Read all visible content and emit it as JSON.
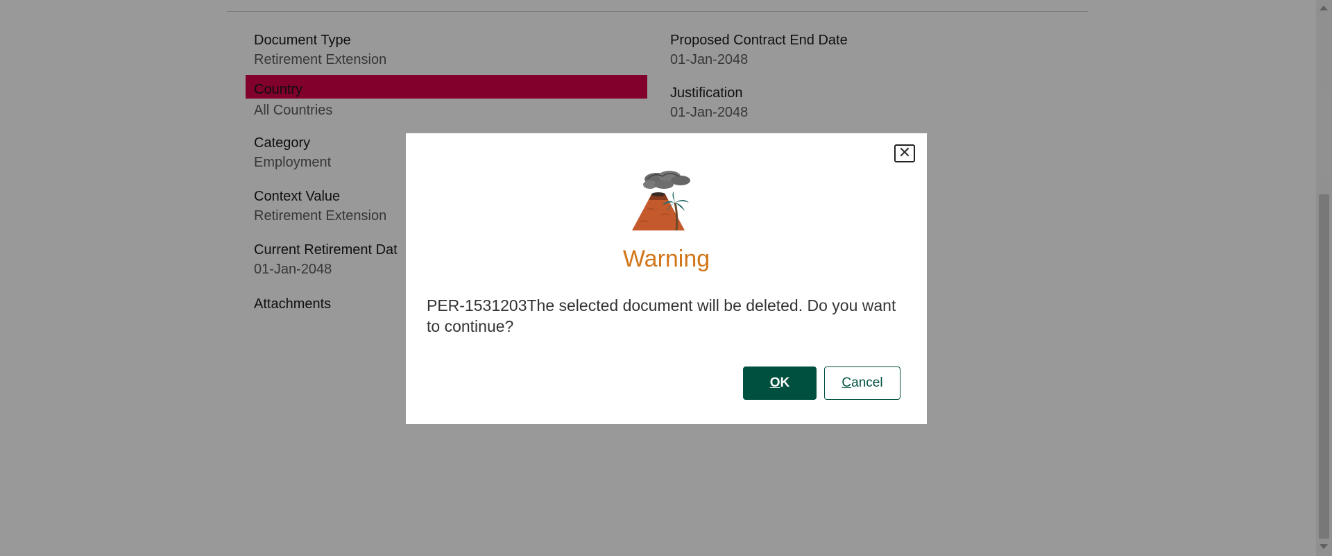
{
  "form": {
    "left_fields": [
      {
        "label": "Document Type",
        "value": "Retirement Extension"
      },
      {
        "label": "Country",
        "value": "All Countries"
      },
      {
        "label": "Category",
        "value": "Employment"
      },
      {
        "label": "Context Value",
        "value": "Retirement Extension"
      },
      {
        "label": "Current Retirement Dat",
        "value": "01-Jan-2048"
      },
      {
        "label": "Attachments",
        "value": ""
      }
    ],
    "right_fields": [
      {
        "label": "Proposed Contract End Date",
        "value": "01-Jan-2048"
      },
      {
        "label": "Justification",
        "value": "01-Jan-2048"
      }
    ]
  },
  "dialog": {
    "close_symbol": "✕",
    "icon": "volcano-icon",
    "title": "Warning",
    "message": "PER-1531203The selected document will be deleted. Do you want to continue?",
    "ok_label": {
      "accel": "O",
      "rest": "K"
    },
    "cancel_label": {
      "accel": "C",
      "rest": "ancel"
    }
  },
  "colors": {
    "accent": "#00503f",
    "warning": "#d2761a",
    "highlight": "#d8004a"
  }
}
